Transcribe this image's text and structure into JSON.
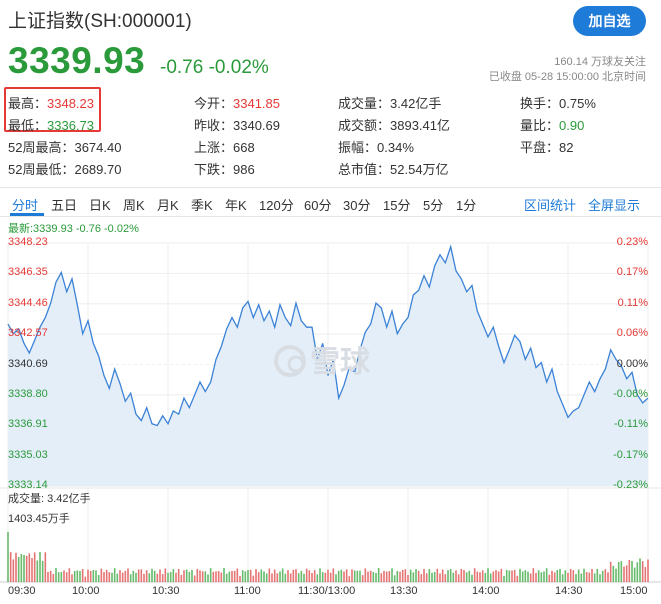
{
  "header": {
    "title": "上证指数(SH:000001)",
    "follow_button": "加自选",
    "price": "3339.93",
    "change": "-0.76 -0.02%",
    "followers": "160.14 万球友关注",
    "status": "已收盘 05-28 15:00:00 北京时间"
  },
  "stats": {
    "high_label": "最高：",
    "high": "3348.23",
    "low_label": "最低：",
    "low": "3336.73",
    "w52_high_label": "52周最高：",
    "w52_high": "3674.40",
    "w52_low_label": "52周最低：",
    "w52_low": "2689.70",
    "open_label": "今开：",
    "open": "3341.85",
    "prev_close_label": "昨收：",
    "prev_close": "3340.69",
    "up_label": "上涨：",
    "up": "668",
    "down_label": "下跌：",
    "down": "986",
    "volume_label": "成交量：",
    "volume": "3.42亿手",
    "amount_label": "成交额：",
    "amount": "3893.41亿",
    "amplitude_label": "振幅：",
    "amplitude": "0.34%",
    "mktcap_label": "总市值：",
    "mktcap": "52.54万亿",
    "turnover_label": "换手：",
    "turnover": "0.75%",
    "volratio_label": "量比：",
    "volratio": "0.90",
    "flat_label": "平盘：",
    "flat": "82"
  },
  "tabs": [
    "分时",
    "五日",
    "日K",
    "周K",
    "月K",
    "季K",
    "年K",
    "120分",
    "60分",
    "30分",
    "15分",
    "5分",
    "1分"
  ],
  "tab_links": [
    "区间统计",
    "全屏显示"
  ],
  "chart_info": {
    "latest": "最新:3339.93 -0.76 -0.02%",
    "volume_label": "成交量: 3.42亿手",
    "volume_max": "1403.45万手",
    "watermark": "雪球"
  },
  "colors": {
    "up": "#e53935",
    "down": "#2b9a3a",
    "accent": "#1f7bd8",
    "line": "#3b82d6",
    "fill": "#e4eef9"
  },
  "chart_data": {
    "type": "line",
    "yticks": [
      "3348.23",
      "3346.35",
      "3344.46",
      "3342.57",
      "3340.69",
      "3338.80",
      "3336.91",
      "3335.03",
      "3333.14"
    ],
    "ypct": [
      "0.23%",
      "0.17%",
      "0.11%",
      "0.06%",
      "0.00%",
      "-0.06%",
      "-0.11%",
      "-0.17%",
      "-0.23%"
    ],
    "ylim": [
      3333.14,
      3348.23
    ],
    "prev_close": 3340.69,
    "xticks": [
      "09:30",
      "10:00",
      "10:30",
      "11:00",
      "11:30/13:00",
      "13:30",
      "14:00",
      "14:30",
      "15:00"
    ],
    "points": [
      [
        0,
        3343.2
      ],
      [
        2,
        3342.6
      ],
      [
        4,
        3342.9
      ],
      [
        6,
        3342.0
      ],
      [
        8,
        3341.4
      ],
      [
        10,
        3342.2
      ],
      [
        12,
        3343.0
      ],
      [
        14,
        3343.6
      ],
      [
        16,
        3344.5
      ],
      [
        18,
        3345.8
      ],
      [
        20,
        3346.4
      ],
      [
        22,
        3345.2
      ],
      [
        24,
        3346.0
      ],
      [
        26,
        3344.4
      ],
      [
        28,
        3342.6
      ],
      [
        30,
        3343.4
      ],
      [
        32,
        3342.0
      ],
      [
        34,
        3341.2
      ],
      [
        36,
        3340.0
      ],
      [
        38,
        3339.2
      ],
      [
        40,
        3340.4
      ],
      [
        42,
        3339.5
      ],
      [
        44,
        3338.4
      ],
      [
        46,
        3338.9
      ],
      [
        48,
        3337.6
      ],
      [
        50,
        3337.2
      ],
      [
        52,
        3338.0
      ],
      [
        54,
        3337.0
      ],
      [
        56,
        3336.9
      ],
      [
        58,
        3337.5
      ],
      [
        60,
        3337.0
      ],
      [
        62,
        3337.8
      ],
      [
        64,
        3337.6
      ],
      [
        66,
        3338.6
      ],
      [
        68,
        3338.0
      ],
      [
        70,
        3338.8
      ],
      [
        72,
        3339.6
      ],
      [
        74,
        3339.0
      ],
      [
        76,
        3339.6
      ],
      [
        78,
        3341.0
      ],
      [
        80,
        3341.8
      ],
      [
        82,
        3342.9
      ],
      [
        84,
        3343.6
      ],
      [
        86,
        3343.0
      ],
      [
        88,
        3344.2
      ],
      [
        90,
        3344.6
      ],
      [
        92,
        3343.6
      ],
      [
        94,
        3344.4
      ],
      [
        96,
        3343.4
      ],
      [
        98,
        3344.0
      ],
      [
        100,
        3343.0
      ],
      [
        102,
        3344.4
      ],
      [
        104,
        3343.6
      ],
      [
        106,
        3343.1
      ],
      [
        108,
        3344.5
      ],
      [
        110,
        3343.4
      ],
      [
        112,
        3343.0
      ],
      [
        114,
        3343.0
      ],
      [
        116,
        3341.0
      ],
      [
        118,
        3342.0
      ],
      [
        120,
        3340.0
      ],
      [
        122,
        3341.0
      ],
      [
        124,
        3338.6
      ],
      [
        126,
        3339.4
      ],
      [
        128,
        3340.5
      ],
      [
        130,
        3340.2
      ],
      [
        132,
        3341.6
      ],
      [
        134,
        3342.7
      ],
      [
        136,
        3343.2
      ],
      [
        138,
        3344.5
      ],
      [
        140,
        3344.2
      ],
      [
        142,
        3343.0
      ],
      [
        144,
        3344.0
      ],
      [
        146,
        3342.6
      ],
      [
        148,
        3343.2
      ],
      [
        150,
        3343.6
      ],
      [
        152,
        3345.0
      ],
      [
        154,
        3345.3
      ],
      [
        156,
        3346.2
      ],
      [
        158,
        3345.5
      ],
      [
        160,
        3346.8
      ],
      [
        162,
        3347.5
      ],
      [
        164,
        3347.0
      ],
      [
        166,
        3348.0
      ],
      [
        168,
        3346.5
      ],
      [
        170,
        3346.0
      ],
      [
        172,
        3345.2
      ],
      [
        174,
        3345.6
      ],
      [
        176,
        3344.0
      ],
      [
        178,
        3343.2
      ],
      [
        180,
        3342.4
      ],
      [
        182,
        3343.0
      ],
      [
        184,
        3341.8
      ],
      [
        186,
        3340.8
      ],
      [
        188,
        3341.6
      ],
      [
        190,
        3342.5
      ],
      [
        192,
        3342.1
      ],
      [
        194,
        3341.0
      ],
      [
        196,
        3341.7
      ],
      [
        198,
        3340.5
      ],
      [
        200,
        3340.8
      ],
      [
        202,
        3339.6
      ],
      [
        204,
        3340.4
      ],
      [
        206,
        3339.0
      ],
      [
        208,
        3338.2
      ],
      [
        210,
        3337.4
      ],
      [
        212,
        3337.8
      ],
      [
        214,
        3338.0
      ],
      [
        216,
        3338.8
      ],
      [
        218,
        3339.6
      ],
      [
        220,
        3339.0
      ],
      [
        222,
        3339.8
      ],
      [
        224,
        3340.4
      ],
      [
        226,
        3341.6
      ],
      [
        228,
        3341.0
      ],
      [
        230,
        3340.6
      ],
      [
        232,
        3339.8
      ],
      [
        234,
        3340.2
      ],
      [
        236,
        3338.8
      ],
      [
        238,
        3338.3
      ],
      [
        240,
        3338.6
      ]
    ]
  }
}
